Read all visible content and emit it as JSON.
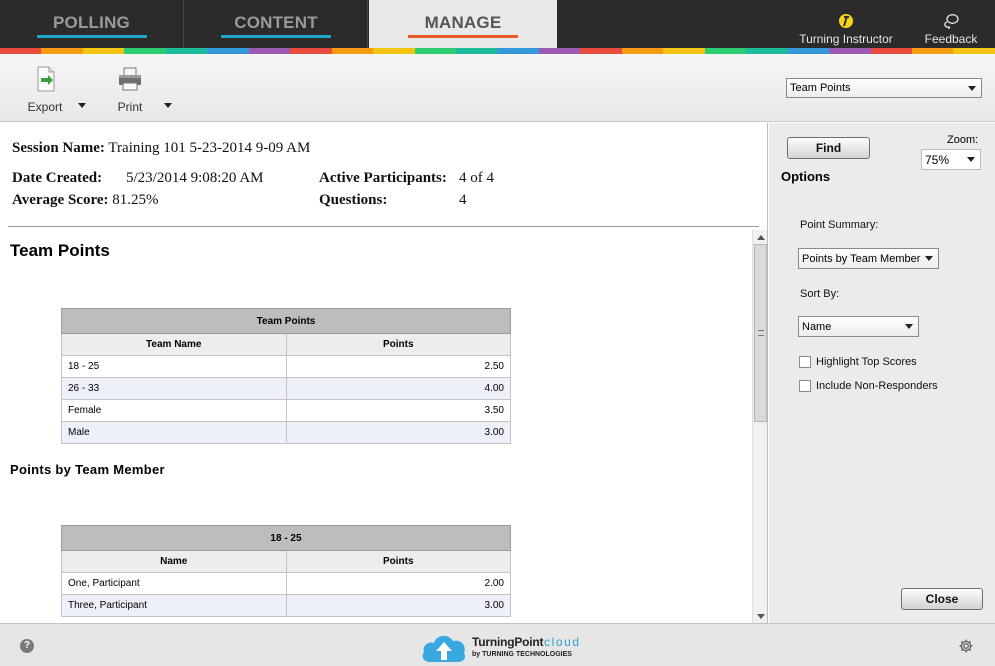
{
  "nav": {
    "tabs": [
      {
        "label": "POLLING"
      },
      {
        "label": "CONTENT"
      },
      {
        "label": "MANAGE"
      }
    ],
    "instructor_label": "Turning Instructor",
    "feedback_label": "Feedback"
  },
  "stripe_colors": [
    "#e84c3d",
    "#f39c12",
    "#f1c40f",
    "#2ecc71",
    "#1abc9c",
    "#3498db",
    "#9b59b6",
    "#e84c3d",
    "#f39c12",
    "#f1c40f",
    "#2ecc71",
    "#1abc9c",
    "#3498db",
    "#9b59b6",
    "#e84c3d",
    "#f39c12",
    "#f1c40f",
    "#2ecc71",
    "#1abc9c",
    "#3498db",
    "#9b59b6",
    "#e84c3d",
    "#f39c12",
    "#f1c40f"
  ],
  "toolbar": {
    "export_label": "Export",
    "print_label": "Print",
    "report_type": "Team Points"
  },
  "session": {
    "name_label": "Session Name:",
    "name_value": "Training 101 5-23-2014 9-09 AM",
    "date_label": "Date Created:",
    "date_value": "5/23/2014 9:08:20 AM",
    "avg_label": "Average Score:",
    "avg_value": "81.25%",
    "active_label": "Active Participants:",
    "active_value": "4 of 4",
    "questions_label": "Questions:",
    "questions_value": "4"
  },
  "report": {
    "title": "Team Points",
    "subtitle": "Points by Team Member",
    "team_table": {
      "caption": "Team Points",
      "col_name": "Team Name",
      "col_points": "Points",
      "rows": [
        {
          "name": "18 - 25",
          "points": "2.50"
        },
        {
          "name": "26 - 33",
          "points": "4.00"
        },
        {
          "name": "Female",
          "points": "3.50"
        },
        {
          "name": "Male",
          "points": "3.00"
        }
      ]
    },
    "member_table": {
      "caption": "18 - 25",
      "col_name": "Name",
      "col_points": "Points",
      "rows": [
        {
          "name": "One, Participant",
          "points": "2.00"
        },
        {
          "name": "Three, Participant",
          "points": "3.00"
        }
      ]
    }
  },
  "options": {
    "find_label": "Find",
    "title": "Options",
    "zoom_label": "Zoom:",
    "zoom_value": "75%",
    "point_summary_label": "Point Summary:",
    "point_summary_value": "Points by Team Member",
    "sort_by_label": "Sort By:",
    "sort_by_value": "Name",
    "highlight_label": "Highlight Top Scores",
    "include_label": "Include Non-Responders",
    "close_label": "Close"
  },
  "footer": {
    "brand_name": "TurningPoint",
    "brand_cloud": "cloud",
    "brand_by": "by TURNING TECHNOLOGIES",
    "help_glyph": "?"
  }
}
